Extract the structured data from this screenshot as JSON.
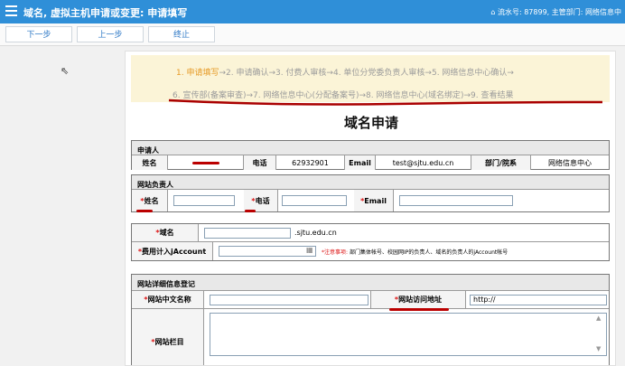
{
  "header": {
    "title": "域名, 虚拟主机申请或变更: 申请填写",
    "user_info": "流水号: 87899, 主管部门: 网络信息中"
  },
  "toolbar": {
    "next": "下一步",
    "prev": "上一步",
    "stop": "终止"
  },
  "steps": {
    "current": "1. 申请填写",
    "line1_rest": "→2. 申请确认→3. 付费人审核→4. 单位分党委负责人审核→5. 网络信息中心确认→",
    "line2": "6. 宣传部(备案审查)→7. 网络信息中心(分配备案号)→8. 网络信息中心(域名绑定)→9. 查看结果"
  },
  "form": {
    "title": "域名申请",
    "applicant": {
      "section": "申请人",
      "name_label": "姓名",
      "phone_label": "电话",
      "phone": "62932901",
      "email_label": "Email",
      "email": "test@sjtu.edu.cn",
      "dept_label": "部门/院系",
      "dept": "网络信息中心"
    },
    "site_owner": {
      "section": "网站负责人",
      "req_mark": "*",
      "name_label": "姓名",
      "phone_label": "电话",
      "email_label": "Email"
    },
    "domain": {
      "label": "域名",
      "suffix": ".sjtu.edu.cn",
      "account_label": "费用计入jAccount",
      "note_prefix": "*注意事项:",
      "note": "部门集体帐号、校园网IP的负责人、域名的负责人的jAccount帐号"
    },
    "site_info": {
      "section": "网站详细信息登记",
      "cn_name_label": "网站中文名称",
      "url_label": "网站访问地址",
      "url_value": "http://",
      "column_label": "网站栏目"
    }
  }
}
